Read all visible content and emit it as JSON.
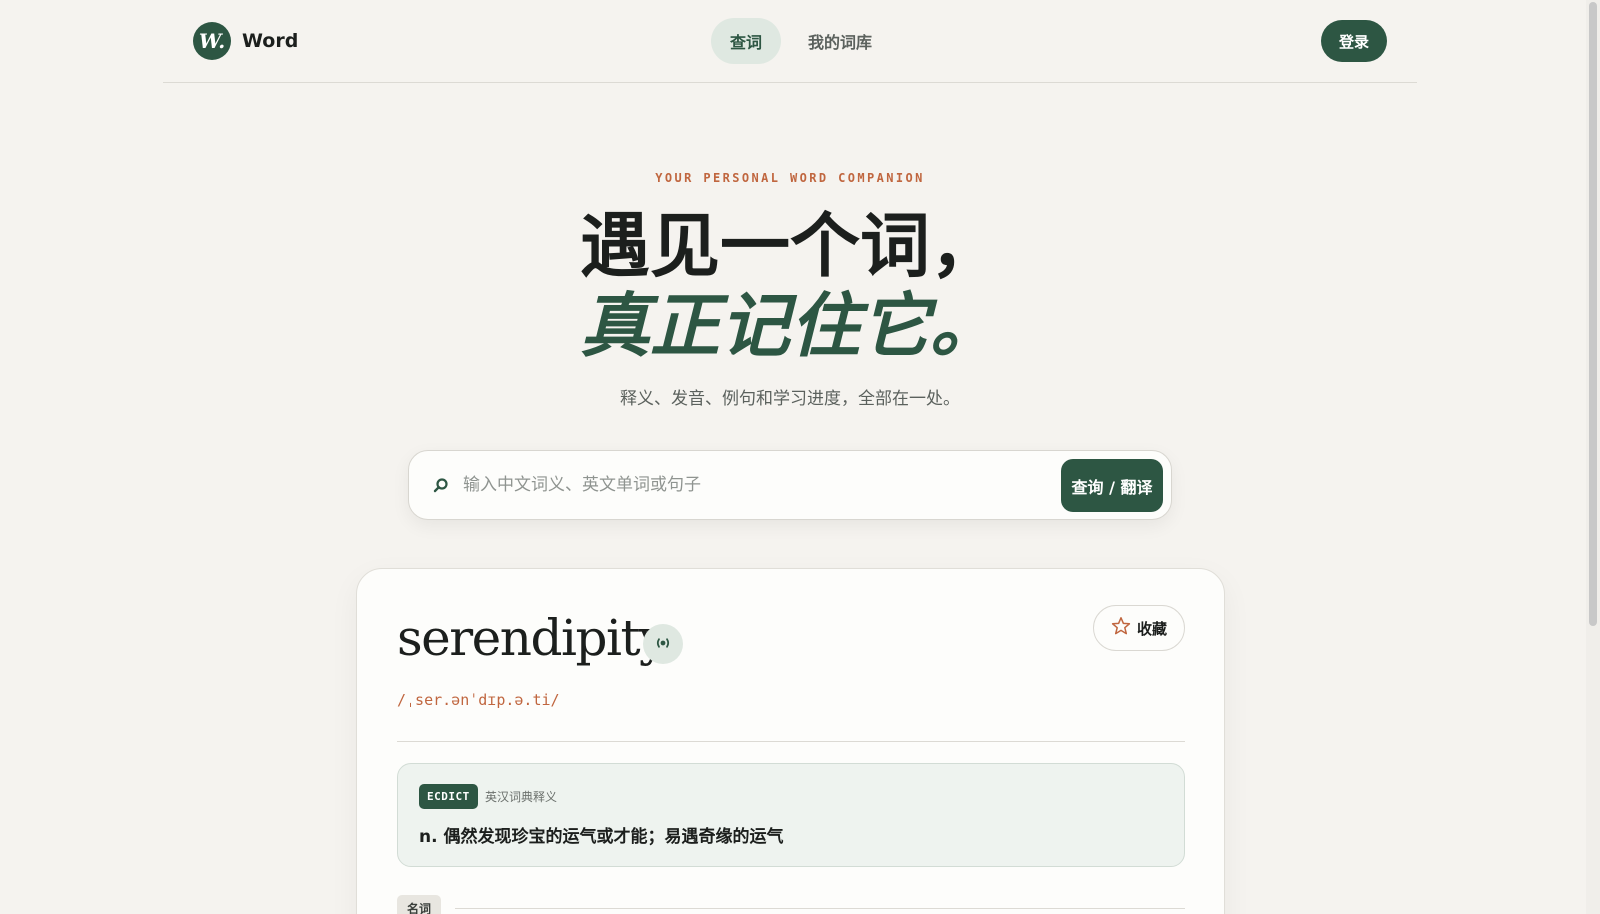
{
  "brand": {
    "mark": "W.",
    "name": "Word"
  },
  "nav": {
    "tabs": [
      {
        "label": "查词",
        "active": true
      },
      {
        "label": "我的词库",
        "active": false
      }
    ]
  },
  "header": {
    "login_label": "登录"
  },
  "hero": {
    "eyebrow": "YOUR PERSONAL WORD COMPANION",
    "line1": "遇见一个词，",
    "line2": "真正记住它。",
    "subtitle": "释义、发音、例句和学习进度，全部在一处。"
  },
  "search": {
    "placeholder": "输入中文词义、英文单词或句子",
    "value": "",
    "button_label": "查询 / 翻译"
  },
  "result": {
    "word": "serendipity",
    "phonetic": "/ˌser.ənˈdɪp.ə.ti/",
    "favorite_label": "收藏",
    "dictionary": {
      "badge": "ECDICT",
      "source": "英汉词典释义",
      "definition": "n. 偶然发现珍宝的运气或才能；易遇奇缘的运气"
    },
    "part_of_speech": "名词"
  },
  "colors": {
    "accent": "#2d5643",
    "accent_soft": "#dfe8e1",
    "highlight": "#c0663f",
    "background": "#f5f3ef"
  }
}
